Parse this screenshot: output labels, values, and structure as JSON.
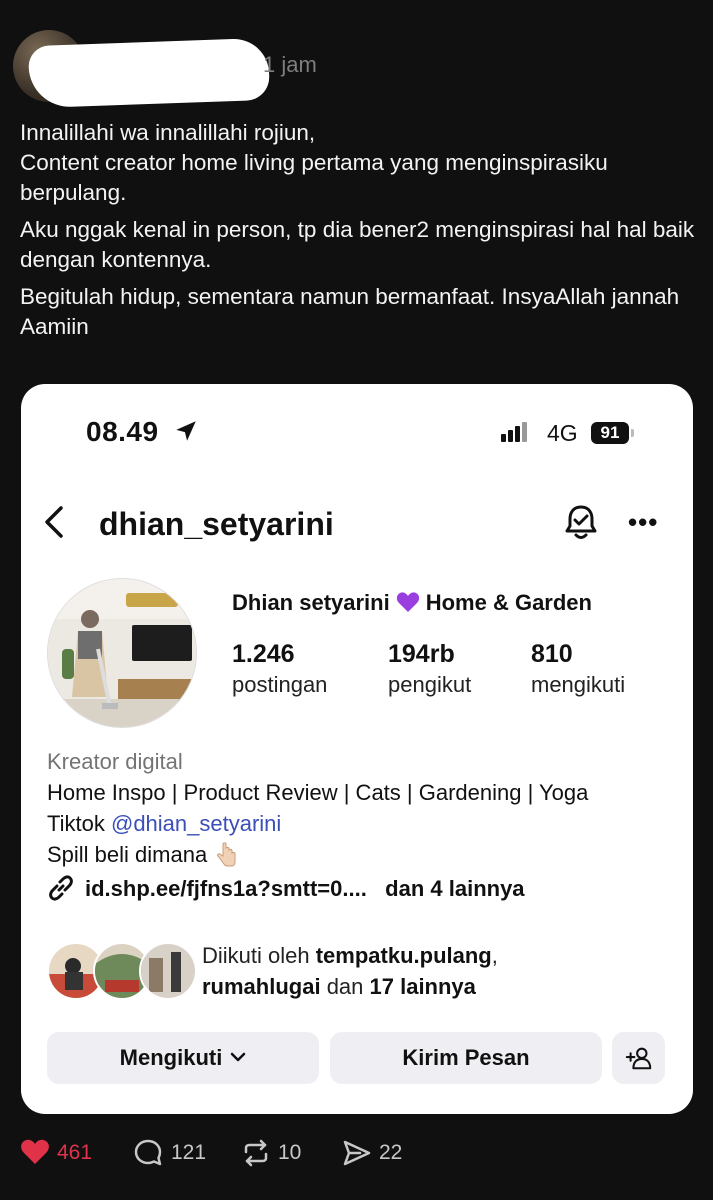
{
  "post": {
    "time": "1 jam",
    "paragraphs": [
      "Innalillahi wa innalillahi rojiun,\nContent creator home living pertama yang menginspirasiku berpulang.",
      "Aku nggak kenal in person, tp dia bener2 menginspirasi hal hal baik dengan kontennya.",
      "Begitulah hidup, sementara namun bermanfaat. InsyaAllah jannah Aamiin"
    ],
    "actions": {
      "likes": "461",
      "replies": "121",
      "reposts": "10",
      "shares": "22"
    },
    "colors": {
      "like": "#e0334a",
      "background": "#101010"
    }
  },
  "screenshot": {
    "status_bar": {
      "time": "08.49",
      "network": "4G",
      "battery": "91"
    },
    "profile": {
      "username": "dhian_setyarini",
      "name_part1": "Dhian setyarini",
      "name_part2": "Home & Garden",
      "stats": [
        {
          "value": "1.246",
          "label": "postingan"
        },
        {
          "value": "194rb",
          "label": "pengikut"
        },
        {
          "value": "810",
          "label": "mengikuti"
        }
      ],
      "category": "Kreator digital",
      "bio_line1": "Home Inspo | Product Review | Cats | Gardening | Yoga",
      "bio_tiktok_prefix": "Tiktok ",
      "bio_tiktok_handle": "@dhian_setyarini",
      "bio_line3": "Spill beli dimana",
      "link": "id.shp.ee/fjfns1a?smtt=0....",
      "link_more": "dan 4 lainnya",
      "followed_by": {
        "prefix": "Diikuti oleh ",
        "user1": "tempatku.pulang",
        "sep": ",",
        "user2": "rumahlugai",
        "mid": " dan ",
        "count": "17 lainnya"
      },
      "buttons": {
        "follow": "Mengikuti",
        "message": "Kirim Pesan"
      }
    }
  }
}
